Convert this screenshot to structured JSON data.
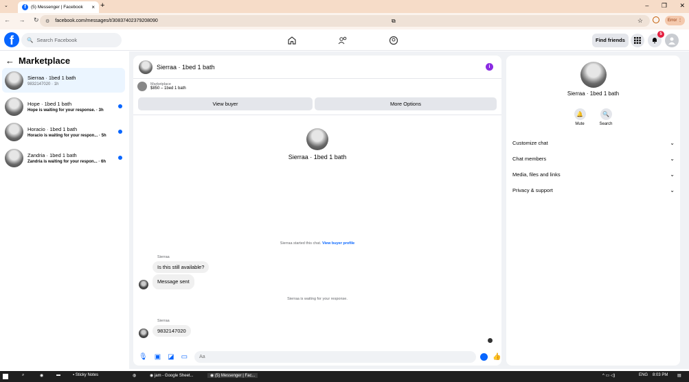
{
  "browser": {
    "tab_title": "(5) Messenger | Facebook",
    "url": "facebook.com/messages/t/30837402379208090",
    "error_label": "Error"
  },
  "fb_header": {
    "search_placeholder": "Search Facebook",
    "find_friends": "Find friends",
    "notification_count": "5"
  },
  "left_panel": {
    "title": "Marketplace",
    "conversations": [
      {
        "name": "Sierraa · 1bed 1 bath",
        "sub": "9832147020 · 1h",
        "active": true,
        "unread": false
      },
      {
        "name": "Hope · 1bed 1 bath",
        "sub": "Hope is waiting for your response. · 3h",
        "active": false,
        "unread": true
      },
      {
        "name": "Horacio · 1bed 1 bath",
        "sub": "Horacio is waiting for your respon... · 5h",
        "active": false,
        "unread": true
      },
      {
        "name": "Zandria · 1bed 1 bath",
        "sub": "Zandria is waiting for your respon... · 6h",
        "active": false,
        "unread": true
      }
    ]
  },
  "chat": {
    "header_name": "Sierraa · 1bed 1 bath",
    "listing_label": "Marketplace",
    "listing_price": "$850 – 1bed 1 bath",
    "view_buyer": "View buyer",
    "more_options": "More Options",
    "profile_name": "Sierraa · 1bed 1 bath",
    "start_note": "Sierraa started this chat.",
    "start_link": "View buyer profile",
    "sender1": "Sierraa",
    "msg1": "Is this still available?",
    "msg2": "Message sent",
    "wait_note": "Sierraa is waiting for your response.",
    "sender2": "Sierraa",
    "msg3": "9832147020",
    "input_placeholder": "Aa"
  },
  "right_panel": {
    "name": "Sierraa · 1bed 1 bath",
    "mute": "Mute",
    "search": "Search",
    "rows": [
      "Customize chat",
      "Chat members",
      "Media, files and links",
      "Privacy & support"
    ]
  },
  "taskbar": {
    "items": [
      "Sticky Notes",
      "jam - Google Sheet...",
      "(5) Messenger | Fac..."
    ],
    "lang": "ENG",
    "time": "8:03 PM"
  }
}
